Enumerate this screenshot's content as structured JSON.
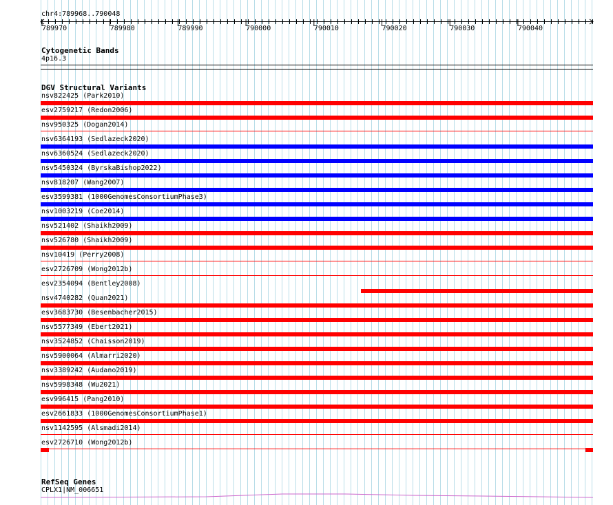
{
  "position": "chr4:789968..790048",
  "ruler": {
    "ticks": [
      "789970",
      "789980",
      "789990",
      "790000",
      "790010",
      "790020",
      "790030",
      "790040"
    ]
  },
  "cytoband": {
    "title": "Cytogenetic Bands",
    "band": "4p16.3"
  },
  "dgv": {
    "title": "DGV Structural Variants",
    "colors": {
      "loss": "#ff0000",
      "gain": "#0000ff"
    },
    "variants": [
      {
        "label": "nsv822425 (Park2010)",
        "color": "loss",
        "bar": "full"
      },
      {
        "label": "esv2759217 (Redon2006)",
        "color": "loss",
        "bar": "full"
      },
      {
        "label": "nsv950325 (Dogan2014)",
        "color": "loss",
        "bar": "thin"
      },
      {
        "label": "nsv6364193 (Sedlazeck2020)",
        "color": "gain",
        "bar": "full"
      },
      {
        "label": "nsv6360524 (Sedlazeck2020)",
        "color": "gain",
        "bar": "full"
      },
      {
        "label": "nsv5450324 (ByrskaBishop2022)",
        "color": "gain",
        "bar": "full"
      },
      {
        "label": "nsv818207 (Wang2007)",
        "color": "gain",
        "bar": "full"
      },
      {
        "label": "esv3599381 (1000GenomesConsortiumPhase3)",
        "color": "gain",
        "bar": "full"
      },
      {
        "label": "nsv1003219 (Coe2014)",
        "color": "gain",
        "bar": "full"
      },
      {
        "label": "nsv521402 (Shaikh2009)",
        "color": "loss",
        "bar": "full"
      },
      {
        "label": "nsv526780 (Shaikh2009)",
        "color": "loss",
        "bar": "full"
      },
      {
        "label": "nsv10419 (Perry2008)",
        "color": "loss",
        "bar": "thin"
      },
      {
        "label": "esv2726709 (Wong2012b)",
        "color": "loss",
        "bar": "thin"
      },
      {
        "label": "esv2354094 (Bentley2008)",
        "color": "loss",
        "bar": "partial"
      },
      {
        "label": "nsv4740282 (Quan2021)",
        "color": "loss",
        "bar": "full"
      },
      {
        "label": "esv3683730 (Besenbacher2015)",
        "color": "loss",
        "bar": "full"
      },
      {
        "label": "nsv5577349 (Ebert2021)",
        "color": "loss",
        "bar": "full"
      },
      {
        "label": "nsv3524852 (Chaisson2019)",
        "color": "loss",
        "bar": "full"
      },
      {
        "label": "nsv5900064 (Almarri2020)",
        "color": "loss",
        "bar": "full"
      },
      {
        "label": "nsv3389242 (Audano2019)",
        "color": "loss",
        "bar": "full"
      },
      {
        "label": "nsv5998348 (Wu2021)",
        "color": "loss",
        "bar": "full"
      },
      {
        "label": "esv996415 (Pang2010)",
        "color": "loss",
        "bar": "full"
      },
      {
        "label": "esv2661833 (1000GenomesConsortiumPhase1)",
        "color": "loss",
        "bar": "full"
      },
      {
        "label": "nsv1142595 (Alsmadi2014)",
        "color": "loss",
        "bar": "thin"
      },
      {
        "label": "esv2726710 (Wong2012b)",
        "color": "loss",
        "bar": "ends"
      }
    ]
  },
  "refseq": {
    "title": "RefSeq Genes",
    "gene": "CPLX1|NM_006651",
    "color": "#cc66cc"
  },
  "grid_color": "#b8dde8"
}
